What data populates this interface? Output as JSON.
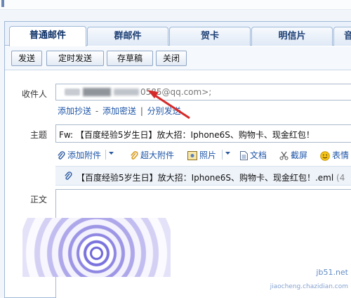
{
  "tabs": [
    {
      "label": "普通邮件"
    },
    {
      "label": "群邮件"
    },
    {
      "label": "贺卡"
    },
    {
      "label": "明信片"
    },
    {
      "label": "音"
    }
  ],
  "toolbar": {
    "send": "发送",
    "scheduled_send": "定时发送",
    "save_draft": "存草稿",
    "close": "关闭"
  },
  "recipient": {
    "label": "收件人",
    "value": "0585@qq.com>;"
  },
  "recipient_links": {
    "add_cc": "添加抄送",
    "dash": " - ",
    "add_bcc": "添加密送",
    "bar": " | ",
    "separate_send": "分别发送"
  },
  "subject": {
    "label": "主题",
    "value": "Fw: 【百度经验5岁生日】放大招：Iphone6S、购物卡、现金红包！"
  },
  "attach_toolbar": {
    "add_attachment": "添加附件",
    "large_attachment": "超大附件",
    "photo": "照片",
    "document": "文档",
    "screenshot": "截屏",
    "emoji": "表情"
  },
  "attached_file": "【百度经验5岁生日】放大招：Iphone6S、购物卡、现金红包！.eml",
  "attached_file_extra": " (4",
  "body": {
    "label": "正文"
  },
  "watermark": {
    "line1": "jb51.net",
    "line2": "jiaocheng.chazidian.com"
  },
  "colors": {
    "link": "#1f56a8",
    "arrow": "#d62a2a",
    "border": "#9fb8d8"
  }
}
